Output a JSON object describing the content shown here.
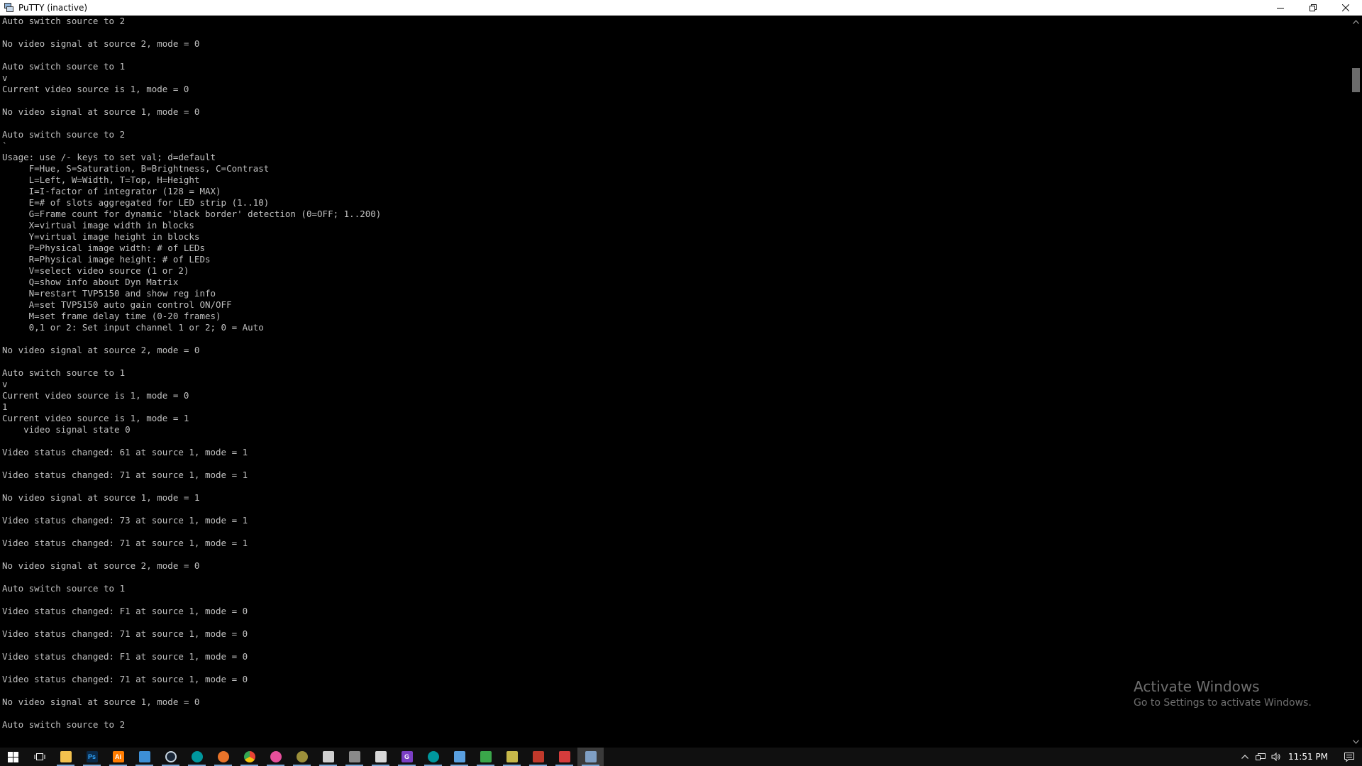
{
  "window": {
    "title": "PuTTY (inactive)",
    "icon": "putty-icon",
    "controls": {
      "minimize": "minimize-icon",
      "restore": "restore-icon",
      "close": "close-icon"
    }
  },
  "terminal": {
    "lines": [
      "Auto switch source to 2",
      "",
      "No video signal at source 2, mode = 0",
      "",
      "Auto switch source to 1",
      "v",
      "Current video source is 1, mode = 0",
      "",
      "No video signal at source 1, mode = 0",
      "",
      "Auto switch source to 2",
      "`",
      "Usage: use /- keys to set val; d=default",
      "     F=Hue, S=Saturation, B=Brightness, C=Contrast",
      "     L=Left, W=Width, T=Top, H=Height",
      "     I=I-factor of integrator (128 = MAX)",
      "     E=# of slots aggregated for LED strip (1..10)",
      "     G=Frame count for dynamic 'black border' detection (0=OFF; 1..200)",
      "     X=virtual image width in blocks",
      "     Y=virtual image height in blocks",
      "     P=Physical image width: # of LEDs",
      "     R=Physical image height: # of LEDs",
      "     V=select video source (1 or 2)",
      "     Q=show info about Dyn Matrix",
      "     N=restart TVP5150 and show reg info",
      "     A=set TVP5150 auto gain control ON/OFF",
      "     M=set frame delay time (0-20 frames)",
      "     0,1 or 2: Set input channel 1 or 2; 0 = Auto",
      "",
      "No video signal at source 2, mode = 0",
      "",
      "Auto switch source to 1",
      "v",
      "Current video source is 1, mode = 0",
      "1",
      "Current video source is 1, mode = 1",
      "    video signal state 0",
      "",
      "Video status changed: 61 at source 1, mode = 1",
      "",
      "Video status changed: 71 at source 1, mode = 1",
      "",
      "No video signal at source 1, mode = 1",
      "",
      "Video status changed: 73 at source 1, mode = 1",
      "",
      "Video status changed: 71 at source 1, mode = 1",
      "",
      "No video signal at source 2, mode = 0",
      "",
      "Auto switch source to 1",
      "",
      "Video status changed: F1 at source 1, mode = 0",
      "",
      "Video status changed: 71 at source 1, mode = 0",
      "",
      "Video status changed: F1 at source 1, mode = 0",
      "",
      "Video status changed: 71 at source 1, mode = 0",
      "",
      "No video signal at source 1, mode = 0",
      "",
      "Auto switch source to 2",
      ""
    ]
  },
  "watermark": {
    "title": "Activate Windows",
    "subtitle": "Go to Settings to activate Windows."
  },
  "taskbar": {
    "items": [
      {
        "name": "start-button",
        "icon": "windows-logo-icon",
        "label": ""
      },
      {
        "name": "task-view-button",
        "icon": "task-view-icon",
        "label": ""
      },
      {
        "name": "taskbar-file-explorer",
        "icon": "folder-icon",
        "label": "",
        "color": "#f2c14e"
      },
      {
        "name": "taskbar-photoshop",
        "icon": "photoshop-icon",
        "label": "Ps",
        "color": "#0a2a4a"
      },
      {
        "name": "taskbar-illustrator",
        "icon": "illustrator-icon",
        "label": "Ai",
        "color": "#ff7c00"
      },
      {
        "name": "taskbar-app-blue",
        "icon": "tool-icon",
        "label": "",
        "color": "#3d8fd6"
      },
      {
        "name": "taskbar-steam",
        "icon": "steam-icon",
        "label": "",
        "color": "#1b2838"
      },
      {
        "name": "taskbar-arduino",
        "icon": "arduino-icon",
        "label": "",
        "color": "#00979d"
      },
      {
        "name": "taskbar-app-orange",
        "icon": "headphones-icon",
        "label": "",
        "color": "#e8742a"
      },
      {
        "name": "taskbar-chrome",
        "icon": "chrome-icon",
        "label": "",
        "color": "#e84335"
      },
      {
        "name": "taskbar-app-pink",
        "icon": "circle-icon",
        "label": "",
        "color": "#e64f9b"
      },
      {
        "name": "taskbar-app-olive",
        "icon": "circle-icon",
        "label": "",
        "color": "#9c8f3a"
      },
      {
        "name": "taskbar-photos",
        "icon": "photos-icon",
        "label": "",
        "color": "#cfcfcf"
      },
      {
        "name": "taskbar-app-gray",
        "icon": "window-icon",
        "label": "",
        "color": "#8a8a8a"
      },
      {
        "name": "taskbar-notepad",
        "icon": "notepad-icon",
        "label": "",
        "color": "#d8d8d8"
      },
      {
        "name": "taskbar-app-purple",
        "icon": "g-icon",
        "label": "G",
        "color": "#7b3fc4"
      },
      {
        "name": "taskbar-arduino-2",
        "icon": "arduino-icon",
        "label": "",
        "color": "#00979d"
      },
      {
        "name": "taskbar-app-grid",
        "icon": "grid-icon",
        "label": "",
        "color": "#5aa0e0"
      },
      {
        "name": "taskbar-app-green",
        "icon": "image-icon",
        "label": "",
        "color": "#3aa64a"
      },
      {
        "name": "taskbar-app-yellow",
        "icon": "chart-icon",
        "label": "",
        "color": "#c6b84a"
      },
      {
        "name": "taskbar-app-stack",
        "icon": "stack-icon",
        "label": "",
        "color": "#c0392b"
      },
      {
        "name": "taskbar-app-red",
        "icon": "app-icon",
        "label": "",
        "color": "#d63c3c"
      },
      {
        "name": "taskbar-putty",
        "icon": "putty-icon",
        "label": "",
        "color": "#7f9fc4",
        "active": true
      }
    ],
    "tray": {
      "chevron": "chevron-up-icon",
      "network": "network-icon",
      "volume": "volume-icon",
      "time": "11:51 PM",
      "notification": "notification-icon"
    }
  }
}
